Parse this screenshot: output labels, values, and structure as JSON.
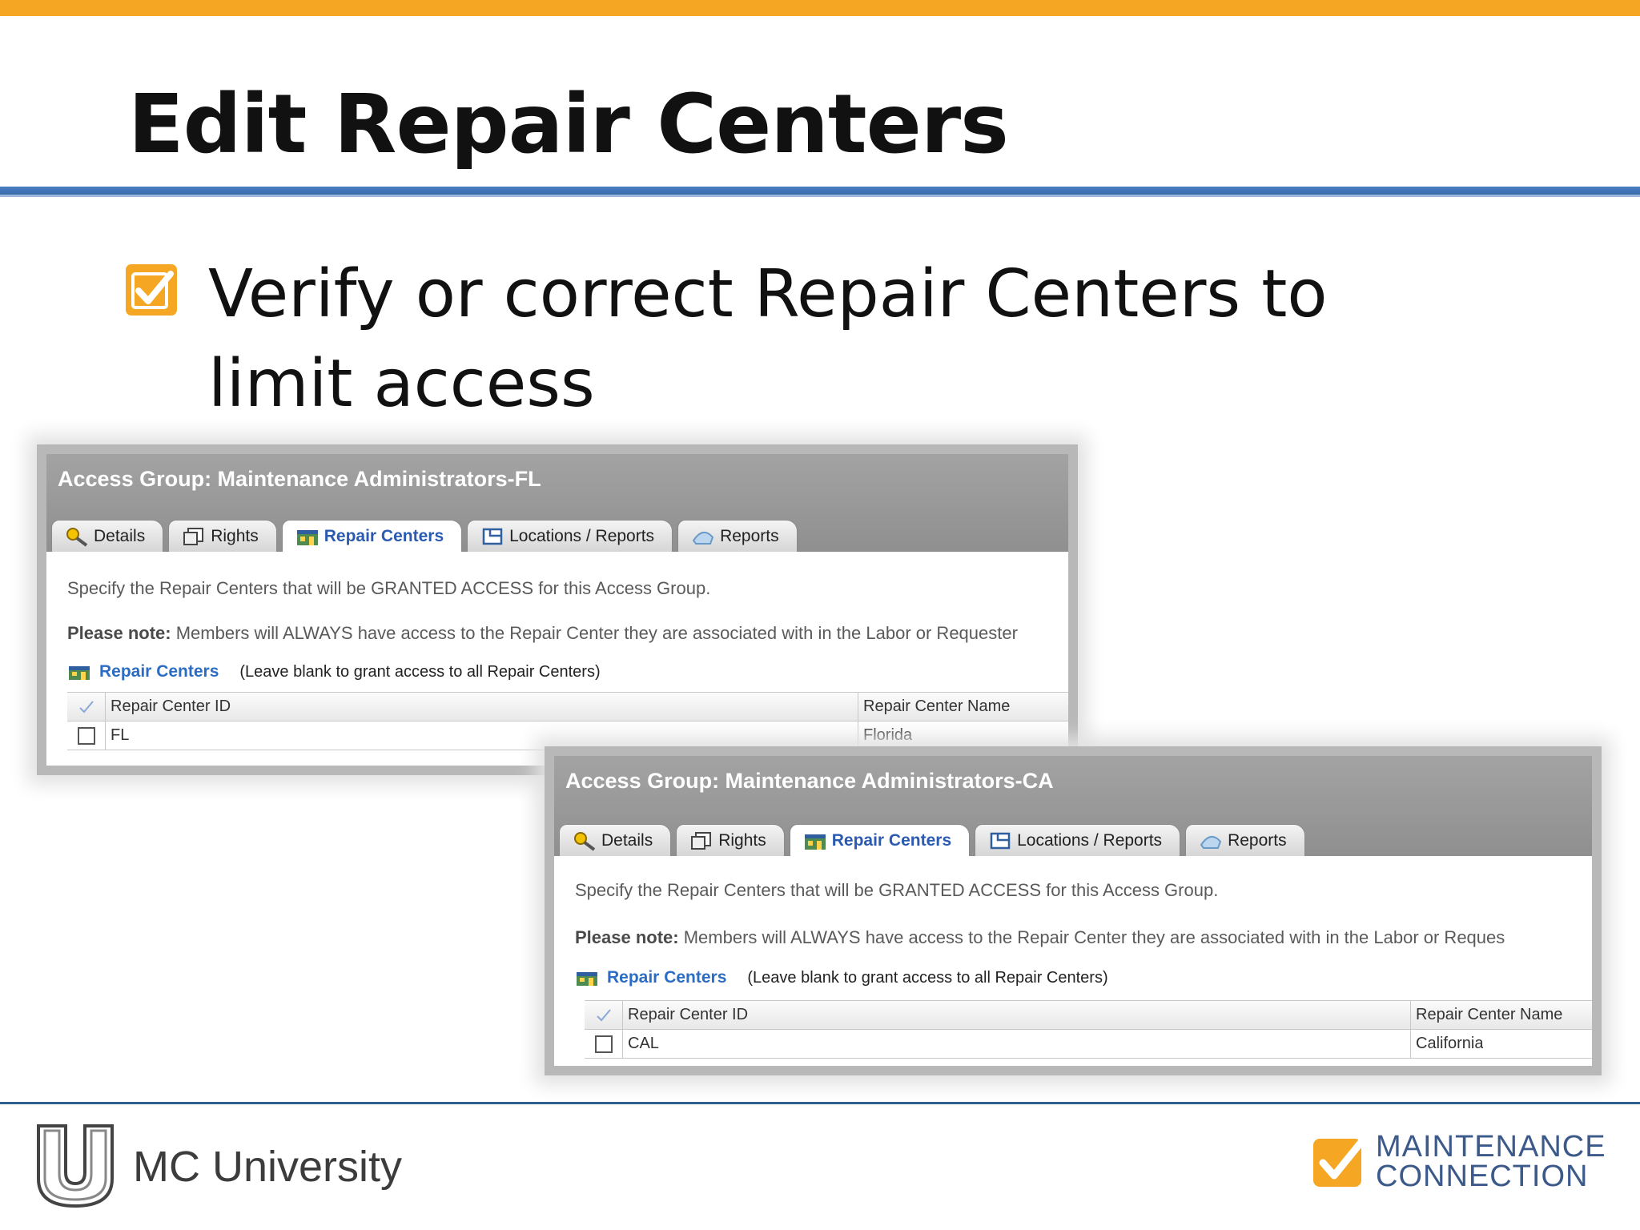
{
  "slide": {
    "title": "Edit Repair Centers",
    "bullet": "Verify or correct Repair Centers to limit access"
  },
  "colors": {
    "accent": "#f5a623",
    "rule": "#4a7fc2",
    "link": "#2450a6",
    "header": "#999999"
  },
  "screens": [
    {
      "header_title": "Access Group: Maintenance Administrators-FL",
      "tabs": [
        {
          "label": "Details",
          "icon": "key-magnifier-icon"
        },
        {
          "label": "Rights",
          "icon": "rights-icon"
        },
        {
          "label": "Repair Centers",
          "icon": "repair-center-icon"
        },
        {
          "label": "Locations / Reports",
          "icon": "locations-icon"
        },
        {
          "label": "Reports",
          "icon": "reports-icon"
        }
      ],
      "active_tab": "Repair Centers",
      "specify_text": "Specify the Repair Centers that will be GRANTED ACCESS for this Access Group.",
      "note_label": "Please note:",
      "note_text": " Members will ALWAYS have access to the Repair Center they are associated with in the Labor or Requester",
      "rc_link": "Repair Centers",
      "rc_note": "(Leave blank to grant access to all Repair Centers)",
      "columns": [
        "Repair Center ID",
        "Repair Center Name"
      ],
      "rows": [
        {
          "id": "FL",
          "name": "Florida"
        }
      ]
    },
    {
      "header_title": "Access Group: Maintenance Administrators-CA",
      "tabs": [
        {
          "label": "Details",
          "icon": "key-magnifier-icon"
        },
        {
          "label": "Rights",
          "icon": "rights-icon"
        },
        {
          "label": "Repair Centers",
          "icon": "repair-center-icon"
        },
        {
          "label": "Locations / Reports",
          "icon": "locations-icon"
        },
        {
          "label": "Reports",
          "icon": "reports-icon"
        }
      ],
      "active_tab": "Repair Centers",
      "specify_text": "Specify the Repair Centers that will be GRANTED ACCESS for this Access Group.",
      "note_label": "Please note:",
      "note_text": " Members will ALWAYS have access to the Repair Center they are associated with in the Labor or Reques",
      "rc_link": "Repair Centers",
      "rc_note": "(Leave blank to grant access to all Repair Centers)",
      "columns": [
        "Repair Center ID",
        "Repair Center Name"
      ],
      "rows": [
        {
          "id": "CAL",
          "name": "California"
        }
      ]
    }
  ],
  "footer": {
    "university": "MC University",
    "logo_line1": "MAINTENANCE",
    "logo_line2": "CONNECTION"
  }
}
